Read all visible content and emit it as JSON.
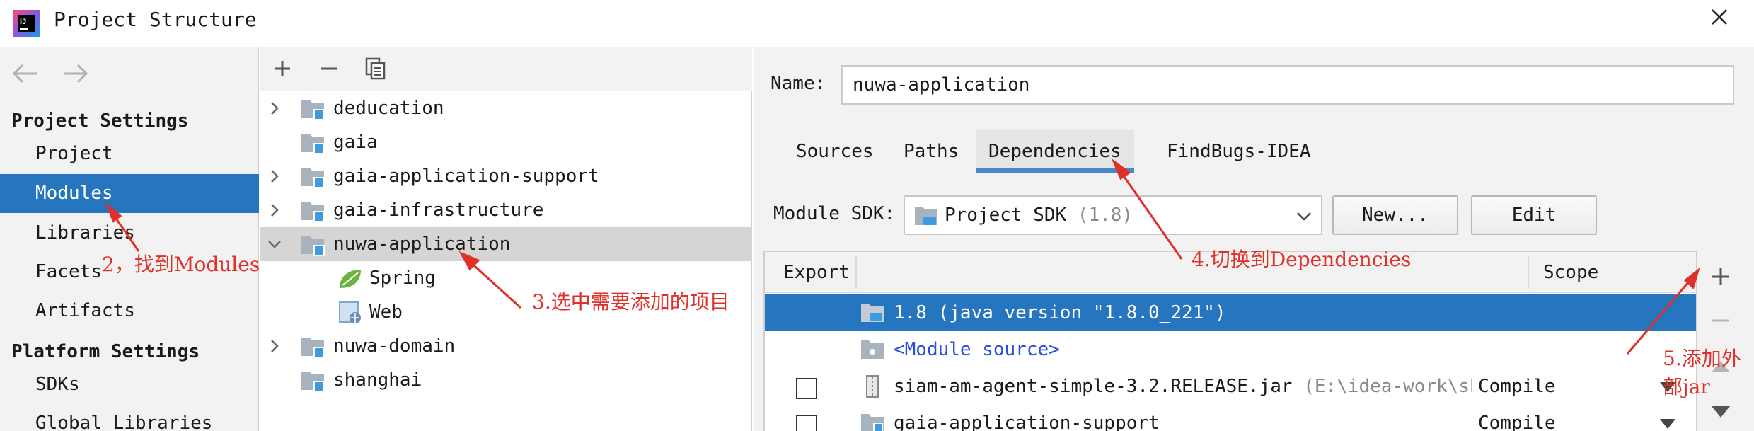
{
  "window": {
    "title": "Project Structure",
    "app_icon": "intellij-icon",
    "close_icon": "close-icon"
  },
  "left_panel": {
    "back_icon": "arrow-left-icon",
    "forward_icon": "arrow-right-icon",
    "project_settings_header": "Project Settings",
    "project_settings_items": [
      "Project",
      "Modules",
      "Libraries",
      "Facets",
      "Artifacts"
    ],
    "selected_item": "Modules",
    "platform_settings_header": "Platform Settings",
    "platform_settings_items": [
      "SDKs",
      "Global Libraries"
    ]
  },
  "middle_panel": {
    "toolbar_icons": [
      "plus-icon",
      "minus-icon",
      "copy-icon"
    ],
    "tree": [
      {
        "label": "deducation",
        "expandable": true
      },
      {
        "label": "gaia",
        "expandable": false
      },
      {
        "label": "gaia-application-support",
        "expandable": true
      },
      {
        "label": "gaia-infrastructure",
        "expandable": true
      },
      {
        "label": "nuwa-application",
        "expandable": true,
        "expanded": true,
        "selected": true
      },
      {
        "label": "Spring",
        "child": true
      },
      {
        "label": "Web",
        "child": true
      },
      {
        "label": "nuwa-domain",
        "expandable": true
      },
      {
        "label": "shanghai",
        "expandable": false
      }
    ]
  },
  "right_panel": {
    "name_label": "Name:",
    "name_value": "nuwa-application",
    "tabs": [
      "Sources",
      "Paths",
      "Dependencies",
      "FindBugs-IDEA"
    ],
    "active_tab": "Dependencies",
    "sdk_label": "Module SDK:",
    "sdk_value": "Project SDK",
    "sdk_version": "(1.8)",
    "new_button": "New...",
    "edit_button": "Edit",
    "table": {
      "headers": {
        "export": "Export",
        "scope": "Scope"
      },
      "rows": [
        {
          "name": "1.8 (java version \"1.8.0_221\")",
          "selected": true
        },
        {
          "name": "<Module source>",
          "link": true
        },
        {
          "name": "siam-am-agent-simple-3.2.RELEASE.jar",
          "path": "(E:\\idea-work\\shanghai\\",
          "scope": "Compile",
          "checkbox": true
        },
        {
          "name": "gaia-application-support",
          "scope": "Compile",
          "checkbox": true
        }
      ]
    },
    "side_tools": [
      "plus-icon",
      "minus-icon",
      "arrow-up-icon",
      "arrow-down-icon"
    ]
  },
  "annotations": {
    "a2": "2，找到Modules",
    "a3": "3.选中需要添加的项目",
    "a4": "4.切换到Dependencies",
    "a5_line1": "5.添加外",
    "a5_line2": "部jar"
  },
  "colors": {
    "selection": "#2675bf",
    "annotation": "#e0302a",
    "folder": "#a9b3bd",
    "module_badge": "#3d9be0"
  }
}
